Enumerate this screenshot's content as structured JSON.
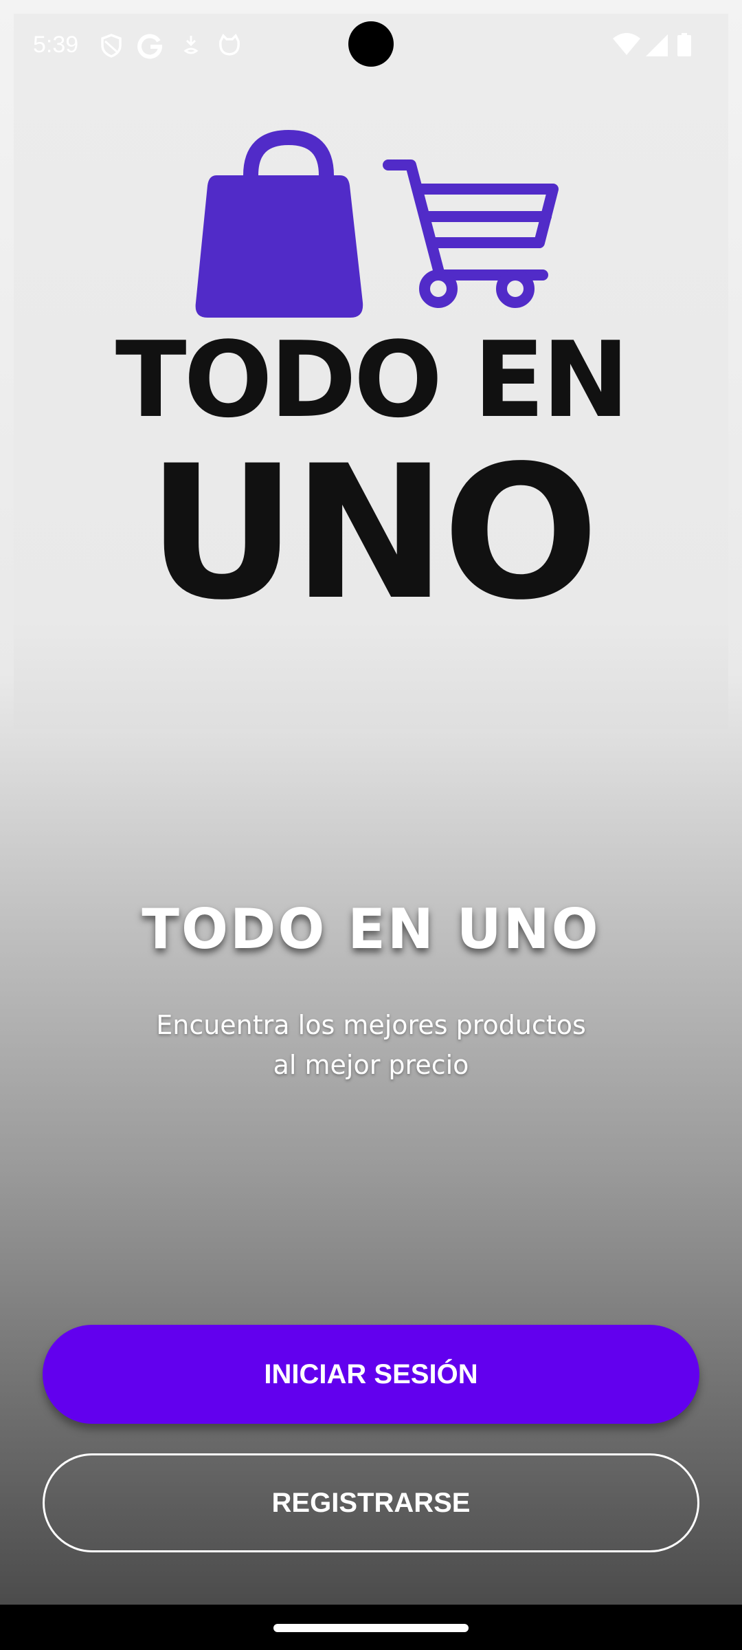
{
  "status_bar": {
    "time": "5:39",
    "left_icons": [
      "shield-icon",
      "google-icon",
      "download-icon",
      "cat-icon"
    ],
    "right_icons": [
      "wifi-icon",
      "signal-icon",
      "battery-icon"
    ]
  },
  "logo": {
    "line1": "TODO EN",
    "line2": "UNO",
    "accent_color": "#512bc8",
    "icons": [
      "shopping-bag-icon",
      "shopping-cart-icon"
    ]
  },
  "welcome": {
    "title": "TODO EN UNO",
    "subtitle": "Encuentra los mejores productos\nal mejor precio"
  },
  "actions": {
    "login_label": "INICIAR SESIÓN",
    "register_label": "REGISTRARSE",
    "primary_color": "#6200ee"
  }
}
